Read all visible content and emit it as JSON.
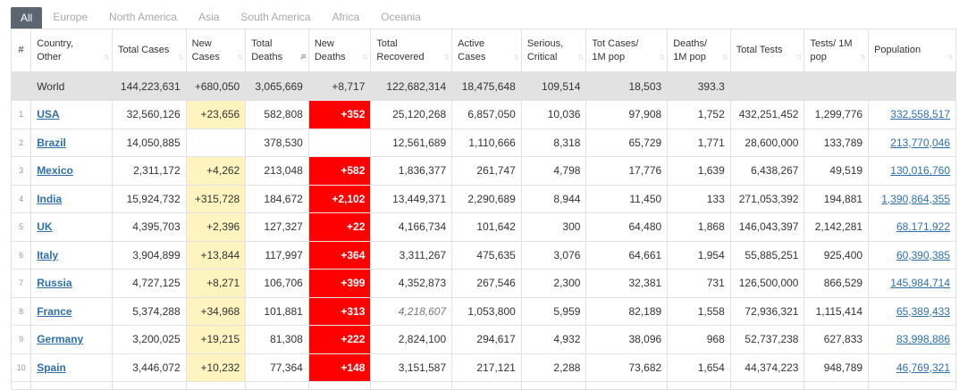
{
  "tabs": [
    {
      "label": "All",
      "active": true
    },
    {
      "label": "Europe"
    },
    {
      "label": "North America"
    },
    {
      "label": "Asia"
    },
    {
      "label": "South America"
    },
    {
      "label": "Africa"
    },
    {
      "label": "Oceania"
    }
  ],
  "headers": [
    {
      "key": "idx",
      "label": "#"
    },
    {
      "key": "country",
      "label": "Country, Other"
    },
    {
      "key": "total_cases",
      "label": "Total Cases"
    },
    {
      "key": "new_cases",
      "label": "New Cases"
    },
    {
      "key": "total_deaths",
      "label": "Total Deaths",
      "sorted": true
    },
    {
      "key": "new_deaths",
      "label": "New Deaths"
    },
    {
      "key": "total_recovered",
      "label": "Total Recovered"
    },
    {
      "key": "active_cases",
      "label": "Active Cases"
    },
    {
      "key": "serious",
      "label": "Serious, Critical"
    },
    {
      "key": "cases_per_1m",
      "label": "Tot Cases/ 1M pop"
    },
    {
      "key": "deaths_per_1m",
      "label": "Deaths/ 1M pop"
    },
    {
      "key": "total_tests",
      "label": "Total Tests"
    },
    {
      "key": "tests_per_1m",
      "label": "Tests/ 1M pop"
    },
    {
      "key": "population",
      "label": "Population"
    }
  ],
  "world": {
    "country": "World",
    "total_cases": "144,223,631",
    "new_cases": "+680,050",
    "total_deaths": "3,065,669",
    "new_deaths": "+8,717",
    "total_recovered": "122,682,314",
    "active_cases": "18,475,648",
    "serious": "109,514",
    "cases_per_1m": "18,503",
    "deaths_per_1m": "393.3",
    "total_tests": "",
    "tests_per_1m": "",
    "population": ""
  },
  "rows": [
    {
      "idx": "1",
      "country": "USA",
      "total_cases": "32,560,126",
      "new_cases": "+23,656",
      "total_deaths": "582,808",
      "new_deaths": "+352",
      "total_recovered": "25,120,268",
      "active_cases": "6,857,050",
      "serious": "10,036",
      "cases_per_1m": "97,908",
      "deaths_per_1m": "1,752",
      "total_tests": "432,251,452",
      "tests_per_1m": "1,299,776",
      "population": "332,558,517"
    },
    {
      "idx": "2",
      "country": "Brazil",
      "total_cases": "14,050,885",
      "new_cases": "",
      "total_deaths": "378,530",
      "new_deaths": "",
      "total_recovered": "12,561,689",
      "active_cases": "1,110,666",
      "serious": "8,318",
      "cases_per_1m": "65,729",
      "deaths_per_1m": "1,771",
      "total_tests": "28,600,000",
      "tests_per_1m": "133,789",
      "population": "213,770,046"
    },
    {
      "idx": "3",
      "country": "Mexico",
      "total_cases": "2,311,172",
      "new_cases": "+4,262",
      "total_deaths": "213,048",
      "new_deaths": "+582",
      "total_recovered": "1,836,377",
      "active_cases": "261,747",
      "serious": "4,798",
      "cases_per_1m": "17,776",
      "deaths_per_1m": "1,639",
      "total_tests": "6,438,267",
      "tests_per_1m": "49,519",
      "population": "130,016,760"
    },
    {
      "idx": "4",
      "country": "India",
      "total_cases": "15,924,732",
      "new_cases": "+315,728",
      "total_deaths": "184,672",
      "new_deaths": "+2,102",
      "total_recovered": "13,449,371",
      "active_cases": "2,290,689",
      "serious": "8,944",
      "cases_per_1m": "11,450",
      "deaths_per_1m": "133",
      "total_tests": "271,053,392",
      "tests_per_1m": "194,881",
      "population": "1,390,864,355"
    },
    {
      "idx": "5",
      "country": "UK",
      "total_cases": "4,395,703",
      "new_cases": "+2,396",
      "total_deaths": "127,327",
      "new_deaths": "+22",
      "total_recovered": "4,166,734",
      "active_cases": "101,642",
      "serious": "300",
      "cases_per_1m": "64,480",
      "deaths_per_1m": "1,868",
      "total_tests": "146,043,397",
      "tests_per_1m": "2,142,281",
      "population": "68,171,922"
    },
    {
      "idx": "6",
      "country": "Italy",
      "total_cases": "3,904,899",
      "new_cases": "+13,844",
      "total_deaths": "117,997",
      "new_deaths": "+364",
      "total_recovered": "3,311,267",
      "active_cases": "475,635",
      "serious": "3,076",
      "cases_per_1m": "64,661",
      "deaths_per_1m": "1,954",
      "total_tests": "55,885,251",
      "tests_per_1m": "925,400",
      "population": "60,390,385"
    },
    {
      "idx": "7",
      "country": "Russia",
      "total_cases": "4,727,125",
      "new_cases": "+8,271",
      "total_deaths": "106,706",
      "new_deaths": "+399",
      "total_recovered": "4,352,873",
      "active_cases": "267,546",
      "serious": "2,300",
      "cases_per_1m": "32,381",
      "deaths_per_1m": "731",
      "total_tests": "126,500,000",
      "tests_per_1m": "866,529",
      "population": "145,984,714"
    },
    {
      "idx": "8",
      "country": "France",
      "total_cases": "5,374,288",
      "new_cases": "+34,968",
      "total_deaths": "101,881",
      "new_deaths": "+313",
      "total_recovered": "4,218,607",
      "recovered_italic": true,
      "active_cases": "1,053,800",
      "serious": "5,959",
      "cases_per_1m": "82,189",
      "deaths_per_1m": "1,558",
      "total_tests": "72,936,321",
      "tests_per_1m": "1,115,414",
      "population": "65,389,433"
    },
    {
      "idx": "9",
      "country": "Germany",
      "total_cases": "3,200,025",
      "new_cases": "+19,215",
      "total_deaths": "81,308",
      "new_deaths": "+222",
      "total_recovered": "2,824,100",
      "active_cases": "294,617",
      "serious": "4,932",
      "cases_per_1m": "38,096",
      "deaths_per_1m": "968",
      "total_tests": "52,737,238",
      "tests_per_1m": "627,833",
      "population": "83,998,886"
    },
    {
      "idx": "10",
      "country": "Spain",
      "total_cases": "3,446,072",
      "new_cases": "+10,232",
      "total_deaths": "77,364",
      "new_deaths": "+148",
      "total_recovered": "3,151,587",
      "active_cases": "217,121",
      "serious": "2,288",
      "cases_per_1m": "73,682",
      "deaths_per_1m": "1,654",
      "total_tests": "44,374,223",
      "tests_per_1m": "948,789",
      "population": "46,769,321"
    }
  ],
  "colors": {
    "new_deaths_bg": "#ff0000",
    "new_cases_bg": "#fef4c0",
    "world_bg": "#e2e2e2",
    "link": "#2e6fac",
    "active_tab": "#5b6670"
  },
  "icons": {
    "sort": "sort-arrows-icon"
  }
}
